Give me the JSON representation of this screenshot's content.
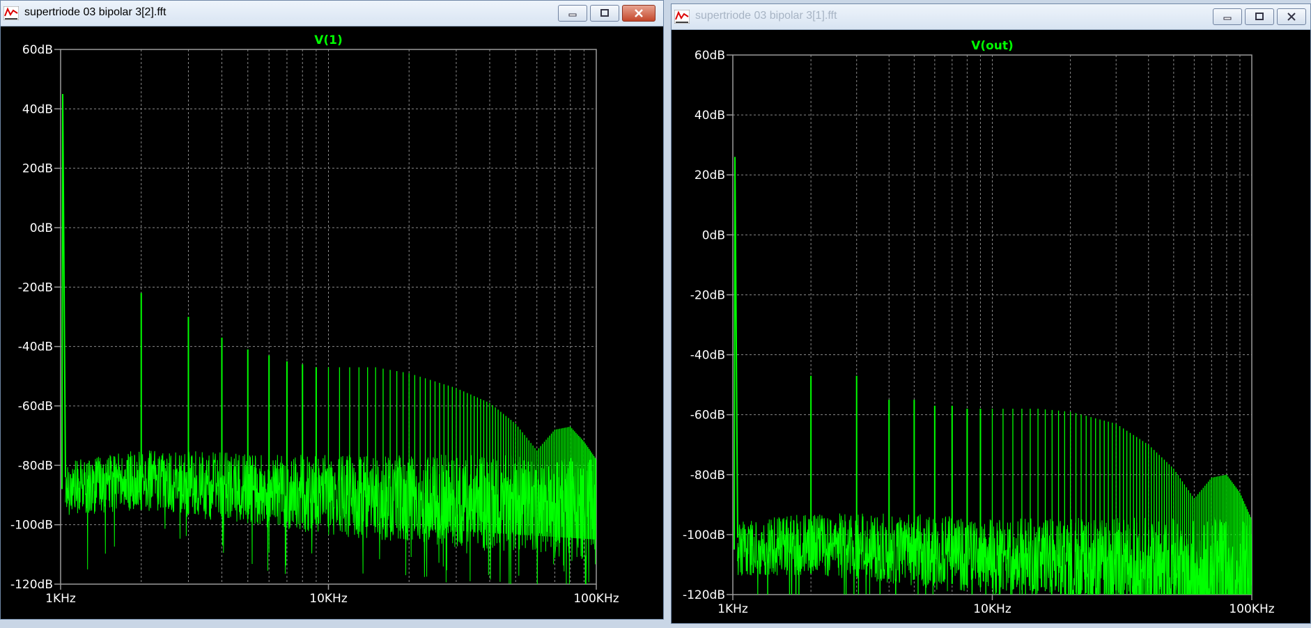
{
  "windows": [
    {
      "title": "supertriode 03 bipolar 3[2].fft",
      "active": true,
      "buttons": {
        "minimize_icon": "minimize-icon",
        "maximize_icon": "maximize-icon",
        "close_icon": "close-icon"
      },
      "chart_data": {
        "type": "line",
        "title": "V(1)",
        "xscale": "log",
        "xlim": [
          1000,
          100000
        ],
        "ylim": [
          -120,
          60
        ],
        "grid": true,
        "y_ticks": [
          "60dB",
          "40dB",
          "20dB",
          "0dB",
          "-20dB",
          "-40dB",
          "-60dB",
          "-80dB",
          "-100dB",
          "-120dB"
        ],
        "x_ticks": [
          "1KHz",
          "10KHz",
          "100KHz"
        ],
        "series": [
          {
            "color": "#00ff00",
            "fundamental": {
              "x": 1000,
              "y": 45
            },
            "harmonic_peaks": [
              {
                "x": 2000,
                "y": -22
              },
              {
                "x": 3000,
                "y": -30
              },
              {
                "x": 4000,
                "y": -37
              },
              {
                "x": 5000,
                "y": -41
              },
              {
                "x": 6000,
                "y": -43
              },
              {
                "x": 7000,
                "y": -45
              },
              {
                "x": 8000,
                "y": -46
              },
              {
                "x": 9000,
                "y": -47
              },
              {
                "x": 10000,
                "y": -47
              },
              {
                "x": 15000,
                "y": -47
              },
              {
                "x": 20000,
                "y": -49
              },
              {
                "x": 30000,
                "y": -54
              },
              {
                "x": 40000,
                "y": -59
              },
              {
                "x": 50000,
                "y": -66
              },
              {
                "x": 60000,
                "y": -75
              },
              {
                "x": 70000,
                "y": -68
              },
              {
                "x": 80000,
                "y": -67
              },
              {
                "x": 90000,
                "y": -72
              },
              {
                "x": 100000,
                "y": -78
              }
            ],
            "noise_floor": [
              {
                "x": 1000,
                "y": -88
              },
              {
                "x": 2000,
                "y": -85
              },
              {
                "x": 5000,
                "y": -88
              },
              {
                "x": 10000,
                "y": -90
              },
              {
                "x": 30000,
                "y": -92
              },
              {
                "x": 100000,
                "y": -95
              }
            ]
          }
        ]
      }
    },
    {
      "title": "supertriode 03 bipolar 3[1].fft",
      "active": false,
      "buttons": {
        "minimize_icon": "minimize-icon",
        "maximize_icon": "maximize-icon",
        "close_icon": "close-icon"
      },
      "chart_data": {
        "type": "line",
        "title": "V(out)",
        "xscale": "log",
        "xlim": [
          1000,
          100000
        ],
        "ylim": [
          -120,
          60
        ],
        "grid": true,
        "y_ticks": [
          "60dB",
          "40dB",
          "20dB",
          "0dB",
          "-20dB",
          "-40dB",
          "-60dB",
          "-80dB",
          "-100dB",
          "-120dB"
        ],
        "x_ticks": [
          "1KHz",
          "10KHz",
          "100KHz"
        ],
        "series": [
          {
            "color": "#00ff00",
            "fundamental": {
              "x": 1000,
              "y": 26
            },
            "harmonic_peaks": [
              {
                "x": 2000,
                "y": -47
              },
              {
                "x": 3000,
                "y": -47
              },
              {
                "x": 4000,
                "y": -55
              },
              {
                "x": 5000,
                "y": -55
              },
              {
                "x": 6000,
                "y": -57
              },
              {
                "x": 7000,
                "y": -57
              },
              {
                "x": 8000,
                "y": -58
              },
              {
                "x": 9000,
                "y": -58
              },
              {
                "x": 10000,
                "y": -58
              },
              {
                "x": 15000,
                "y": -58
              },
              {
                "x": 20000,
                "y": -59
              },
              {
                "x": 30000,
                "y": -63
              },
              {
                "x": 40000,
                "y": -70
              },
              {
                "x": 50000,
                "y": -78
              },
              {
                "x": 60000,
                "y": -88
              },
              {
                "x": 70000,
                "y": -81
              },
              {
                "x": 80000,
                "y": -80
              },
              {
                "x": 90000,
                "y": -86
              },
              {
                "x": 100000,
                "y": -95
              }
            ],
            "noise_floor": [
              {
                "x": 1000,
                "y": -105
              },
              {
                "x": 2000,
                "y": -103
              },
              {
                "x": 5000,
                "y": -105
              },
              {
                "x": 10000,
                "y": -108
              },
              {
                "x": 30000,
                "y": -110
              },
              {
                "x": 100000,
                "y": -112
              }
            ]
          }
        ]
      }
    }
  ]
}
